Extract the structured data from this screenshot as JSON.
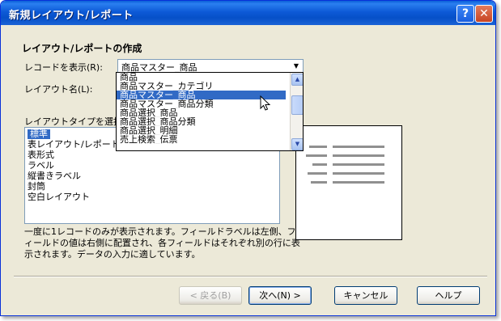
{
  "window": {
    "title": "新規レイアウト/レポート",
    "help": "?",
    "close": "✕"
  },
  "heading": "レイアウト/レポートの作成",
  "record_label": "レコードを表示(R):",
  "record_value": "商品マスター_商品",
  "name_label": "レイアウト名(L):",
  "type_label": "レイアウトタイプを選択(S)",
  "dropdown_items": [
    "商品",
    "商品マスター_カテゴリ",
    "商品マスター_商品",
    "商品マスター_商品分類",
    "商品選択_商品",
    "商品選択_商品分類",
    "商品選択_明細",
    "売上検索_伝票"
  ],
  "dropdown_selected_index": 2,
  "layout_types": [
    "標準",
    "表レイアウト/レポート",
    "表形式",
    "ラベル",
    "縦書きラベル",
    "封筒",
    "空白レイアウト"
  ],
  "layout_selected_index": 0,
  "description": "一度に1レコードのみが表示されます。フィールドラベルは左側、フィールドの値は右側に配置され、各フィールドはそれぞれ別の行に表示されます。データの入力に適しています。",
  "buttons": {
    "back": "< 戻る(B)",
    "next": "次へ(N) >",
    "cancel": "キャンセル",
    "help": "ヘルプ"
  }
}
